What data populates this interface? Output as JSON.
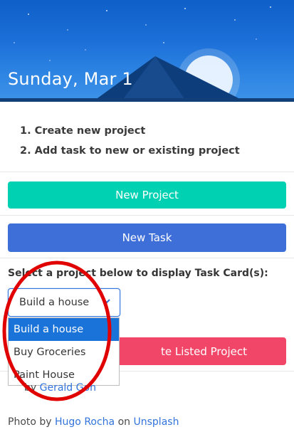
{
  "hero": {
    "date": "Sunday, Mar 1"
  },
  "steps": [
    "1. Create new project",
    "2. Add task to new or existing project"
  ],
  "buttons": {
    "new_project": "New Project",
    "new_task": "New Task",
    "delete_project": "Delete Listed Project",
    "delete_project_visible": "te Listed Project"
  },
  "project_select": {
    "label": "Select a project below to display Task Card(s):",
    "selected": "Build a house",
    "options": [
      "Build a house",
      "Buy Groceries",
      "Paint House"
    ]
  },
  "footer": {
    "built_by_prefix": "Built by",
    "built_by_visible_prefix": "by",
    "author": "Gerald Goh",
    "author_visible": "Gerald Goh",
    "photo_prefix": "Photo by",
    "photographer": "Hugo Rocha",
    "on": "on",
    "site": "Unsplash"
  },
  "colors": {
    "primary": "#00d1b2",
    "task": "#3e6fd8",
    "danger": "#f14668",
    "link": "#3273dc",
    "annotation": "#e00000"
  }
}
